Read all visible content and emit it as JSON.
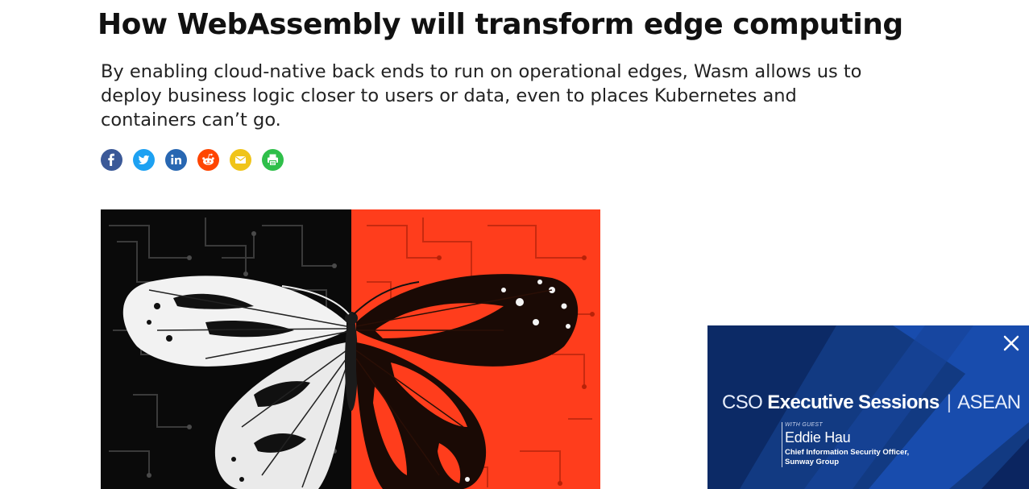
{
  "article": {
    "headline": "How WebAssembly will transform edge computing",
    "dek": "By enabling cloud-native back ends to run on operational edges, Wasm allows us to deploy business logic closer to users or data, even to places Kubernetes and containers can’t go."
  },
  "share": {
    "buttons": [
      {
        "network": "Facebook",
        "icon": "facebook-icon",
        "color": "#3b5998"
      },
      {
        "network": "Twitter",
        "icon": "twitter-icon",
        "color": "#1da1f2"
      },
      {
        "network": "LinkedIn",
        "icon": "linkedin-icon",
        "color": "#2867b2"
      },
      {
        "network": "Reddit",
        "icon": "reddit-icon",
        "color": "#ff4500"
      },
      {
        "network": "Email",
        "icon": "email-icon",
        "color": "#f0c419"
      },
      {
        "network": "Print",
        "icon": "print-icon",
        "color": "#2fbf4a"
      }
    ]
  },
  "hero_image": {
    "subject": "butterfly split over circuit-board background",
    "colors": {
      "left": "#0a0a0a",
      "right": "#ff3d1c"
    }
  },
  "ad": {
    "brand": "CSO",
    "title": "Executive Sessions",
    "separator": "|",
    "region": "ASEAN",
    "with_guest": "WITH GUEST",
    "guest_name": "Eddie Hau",
    "guest_role_line1": "Chief Information Security Officer,",
    "guest_role_line2": "Sunway Group",
    "close_icon": "close-icon",
    "colors": {
      "background": "#123a82",
      "accent": "#1e5bd1"
    }
  }
}
